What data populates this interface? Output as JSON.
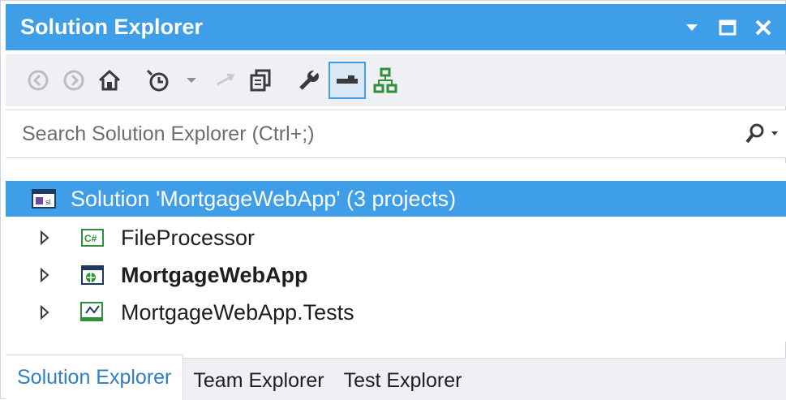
{
  "colors": {
    "accent": "#3f9ee8",
    "toolbar_bg": "#eef0f4",
    "selected_text": "#ffffff",
    "active_tab_text": "#2f7fc4"
  },
  "window": {
    "title": "Solution Explorer",
    "controls": [
      "dropdown-arrow-icon",
      "maximize-icon",
      "close-icon"
    ]
  },
  "toolbar": {
    "buttons": [
      "back-icon",
      "forward-icon",
      "home-icon",
      "pending-changes-icon",
      "dropdown-arrow-icon",
      "sync-icon",
      "collapse-all-icon",
      "properties-icon",
      "preview-icon",
      "class-view-icon"
    ],
    "active_button": "preview-icon"
  },
  "search": {
    "placeholder": "Search Solution Explorer (Ctrl+;)"
  },
  "tree": {
    "solution": {
      "label": "Solution 'MortgageWebApp' (3 projects)",
      "icon": "solution-icon"
    },
    "projects": [
      {
        "label": "FileProcessor",
        "icon": "csharp-project-icon",
        "bold": false
      },
      {
        "label": "MortgageWebApp",
        "icon": "web-project-icon",
        "bold": true
      },
      {
        "label": "MortgageWebApp.Tests",
        "icon": "test-project-icon",
        "bold": false
      }
    ]
  },
  "tabs": [
    {
      "label": "Solution Explorer",
      "active": true
    },
    {
      "label": "Team Explorer",
      "active": false
    },
    {
      "label": "Test Explorer",
      "active": false
    }
  ]
}
